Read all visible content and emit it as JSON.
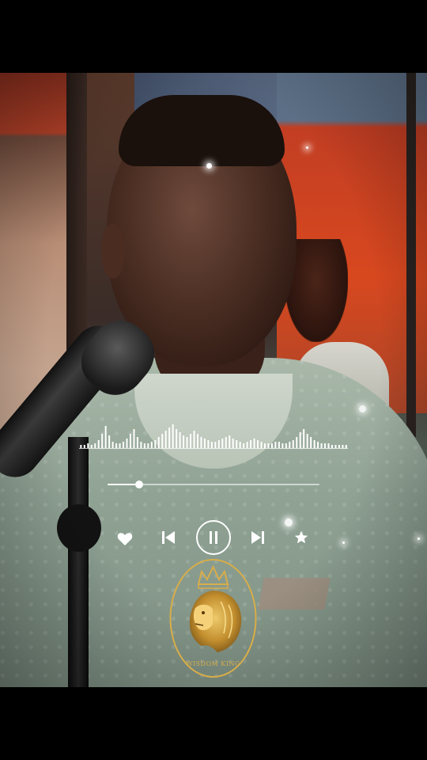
{
  "player": {
    "state": "playing",
    "progress": 0.15,
    "controls": {
      "like_icon": "heart-icon",
      "prev_icon": "skip-back-icon",
      "play_pause_icon": "pause-icon",
      "next_icon": "skip-forward-icon",
      "favorite_icon": "star-icon"
    },
    "waveform_levels": [
      2,
      2,
      3,
      2,
      3,
      5,
      9,
      14,
      8,
      4,
      3,
      3,
      4,
      6,
      9,
      12,
      7,
      4,
      3,
      3,
      4,
      5,
      7,
      9,
      11,
      13,
      15,
      12,
      10,
      8,
      7,
      9,
      11,
      9,
      7,
      6,
      5,
      4,
      4,
      5,
      6,
      7,
      8,
      6,
      5,
      4,
      3,
      4,
      5,
      6,
      5,
      4,
      3,
      3,
      3,
      4,
      4,
      3,
      3,
      4,
      5,
      7,
      10,
      12,
      9,
      7,
      5,
      4,
      3,
      3,
      3,
      2,
      2,
      2,
      2,
      2
    ]
  },
  "logo": {
    "icon": "lion-crown-icon",
    "text": "WISDOM KING",
    "color": "#d8ad4a"
  }
}
